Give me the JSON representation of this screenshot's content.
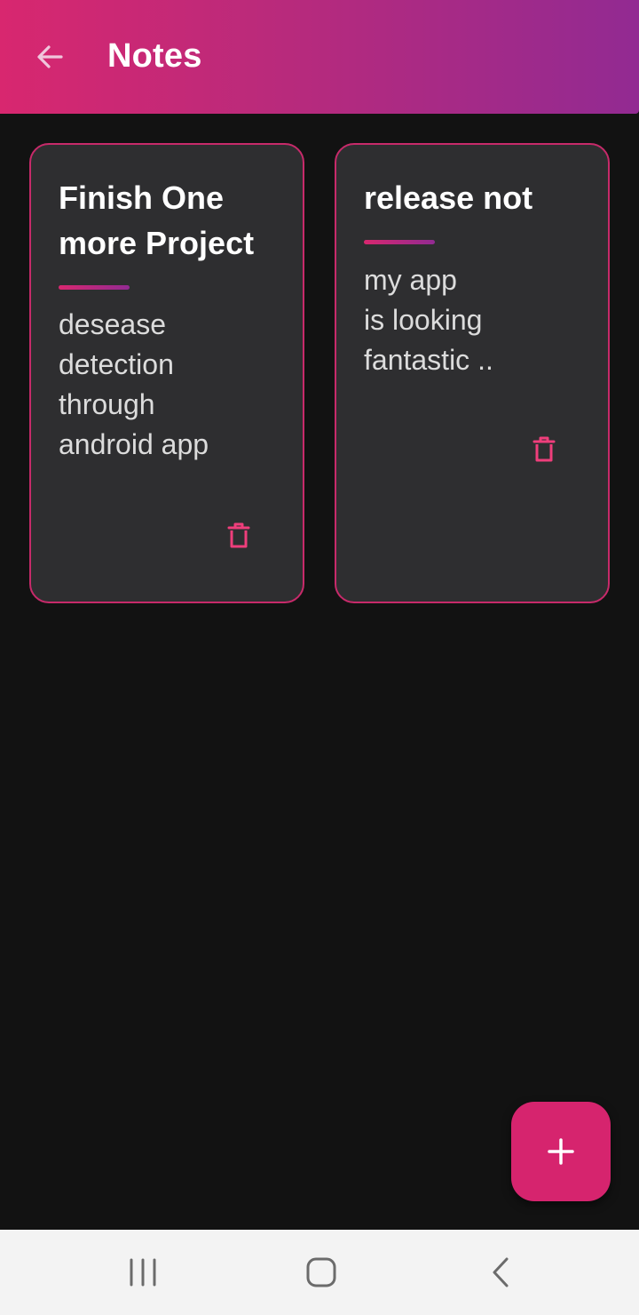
{
  "app_bar": {
    "title": "Notes",
    "back_icon": "arrow-left-icon",
    "gradient": [
      "#d8276f",
      "#922a92"
    ]
  },
  "notes": [
    {
      "title": "Finish One more Project",
      "body": "desease\ndetection\nthrough\nandroid app",
      "delete_icon": "trash-icon"
    },
    {
      "title": "release not",
      "body": "my app\nis looking\nfantastic ..",
      "delete_icon": "trash-icon"
    }
  ],
  "fab": {
    "icon": "plus-icon"
  },
  "colors": {
    "accent": "#d6246e",
    "card_border": "#c72a6a",
    "card_bg": "#2e2e30",
    "background": "#121212"
  },
  "system_nav": {
    "recents_icon": "recents-icon",
    "home_icon": "home-icon",
    "back_icon": "chevron-left-icon"
  }
}
